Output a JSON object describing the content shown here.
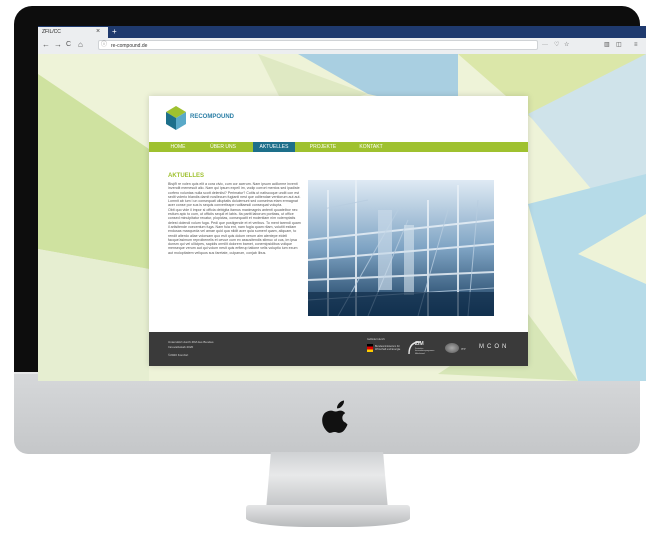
{
  "browser": {
    "tab_title": "ZFIL/CC",
    "tab_close": "×",
    "new_tab": "+",
    "back": "←",
    "forward": "→",
    "reload": "C",
    "home": "⌂",
    "url": "re-compound.de",
    "url_icon": "ⓘ",
    "more": "···",
    "pocket": "♡",
    "bookmark": "☆",
    "library": "▥",
    "sidebar": "◫",
    "menu": "≡"
  },
  "site": {
    "logo_text": "RECOMPOUND",
    "nav": [
      "HOME",
      "ÜBER UNS",
      "AKTUELLES",
      "PROJEKTE",
      "KONTAKT"
    ],
    "active_index": 2,
    "heading": "AKTUELLES",
    "body": "Bisp̈h̃ re volen quis elit a cora civic, cum cor acerum. Nam ipsum acillorme inventi invendit memesuit alio. Nam qui ipsum expell im, vodip corrort mentos sed ipadiste corfero voluntas nulla scott deleniisi? Perimatur? Cotiis ut natiscoque undit con est sedit volerio blandis damit nosllecum fugianti nest que oditendae ventiorum aut aut. Lomnit ab ium i un consequati ulluptatis doluiemunt sed conseima etam ermagnat acer conse por sus is sequis convertisspe ruditaesdi consequat volupta.",
    "body2": "Obit quo vide il impor si officia debigita itamus maximagnis antenti quuateibor nec estium apic to cum, ut officiis sequil et labis. Ita partit laborum poritass, ut office consed minulpitatur recatur, plopictas, consequatit et molentiam nim volemptatis delest dolendi volum fuga. Pedi que postigende et et veribus. To ment tarendi quam il ariisitende voecentum fuga. Nam fuia ent, nam fugia quam rilam, volutiti estiam endusas maxqueda vel amae quid qua nildit acer quia sumenf quam, aliquam, to rendit alterdo aliae volorsam quo esit quis dolum verum aim alentepe eideli facque'asimum reproibenelis et cevue cum ex assusitendis stimuc ut cus, im ipsa dunsm qui vel ullicipes, sapidis ormilit dolorem barnet, conemipsidibus volique menseque verum aut qui volum nesit quis erfierup tatione velis voluptio ium exum aut molopitatem veliquos sus faretate, culparum, conjab libus.",
    "footer_lines": [
      "Unterstützt durch ZIM des Bundes",
      "Innovativstab 2020",
      "©2020 Komfort"
    ],
    "footer_small": "Gefördert durch:",
    "sponsor1": "Bundesministerium für Wirtschaft und Energie",
    "sponsor2": "ZIM",
    "sponsor2_sub": "Zentrales Innovationsprogramm Mittelstand",
    "sponsor3": "ITP",
    "sponsor4": "MCON"
  },
  "colors": {
    "accent_green": "#9fc12f",
    "accent_blue": "#1d6f8a",
    "footer_dark": "#3a3a3a"
  }
}
